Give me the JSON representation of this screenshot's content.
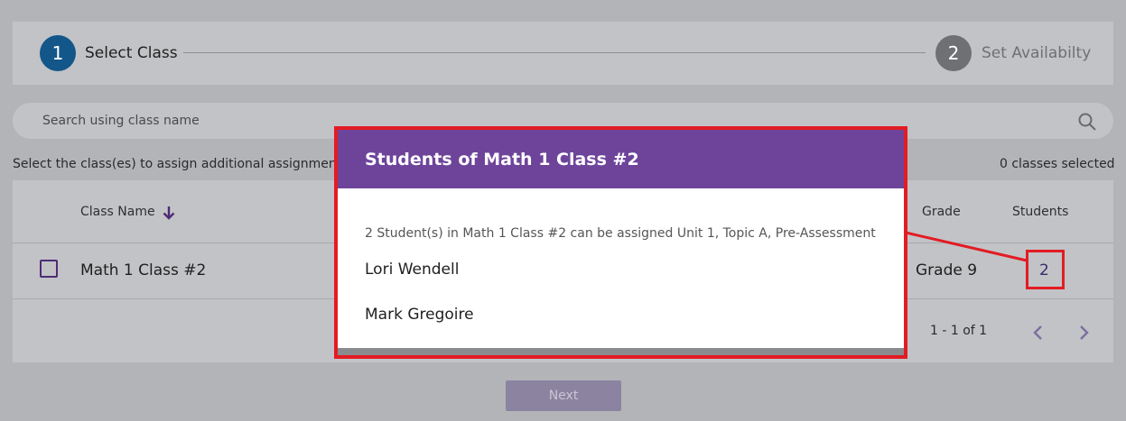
{
  "stepper": {
    "steps": [
      {
        "number": "1",
        "label": "Select Class"
      },
      {
        "number": "2",
        "label": "Set Availabilty"
      }
    ]
  },
  "search": {
    "placeholder": "Search using class name"
  },
  "hint_text": "Select the class(es) to assign additional assignmen",
  "selected_count": "0 classes selected",
  "table": {
    "headers": {
      "class_name": "Class Name",
      "grade": "Grade",
      "students": "Students"
    },
    "rows": [
      {
        "class_name": "Math 1 Class #2",
        "grade": "Grade 9",
        "students": "2"
      }
    ]
  },
  "pagination": {
    "range": "1 - 1 of 1"
  },
  "next_button": "Next",
  "dialog": {
    "title": "Students of Math 1 Class #2",
    "description": "2 Student(s) in Math 1 Class #2 can be assigned Unit 1, Topic A, Pre-Assessment",
    "students": [
      "Lori Wendell",
      "Mark Gregoire"
    ]
  },
  "colors": {
    "primary_step": "#13568a",
    "dialog_header": "#6e449b",
    "highlight": "#e31b23"
  }
}
